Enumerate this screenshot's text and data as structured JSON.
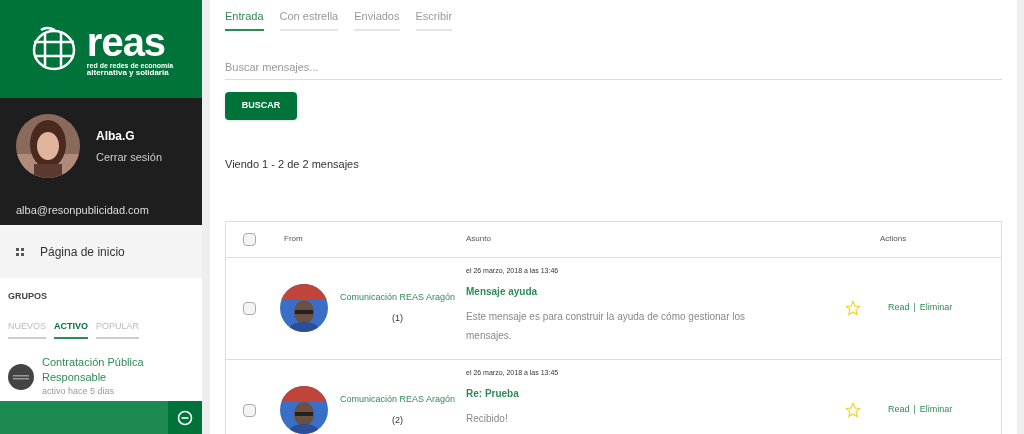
{
  "logo": {
    "name": "reas",
    "tagline_1": "red de redes de economía",
    "tagline_2": "alternativa y solidaria"
  },
  "user": {
    "name": "Alba.G",
    "logout": "Cerrar sesión",
    "email": "alba@resonpublicidad.com"
  },
  "nav": [
    {
      "label": "Página de inicio"
    }
  ],
  "groups": {
    "title": "GRUPOS",
    "tabs": [
      {
        "label": "NUEVOS",
        "selected": false
      },
      {
        "label": "ACTIVO",
        "selected": true
      },
      {
        "label": "POPULAR",
        "selected": false
      }
    ],
    "items": [
      {
        "name": "Contratación Pública Responsable",
        "activity": "activo hace 5 dias"
      }
    ]
  },
  "tabs": [
    {
      "label": "Entrada",
      "selected": true
    },
    {
      "label": "Con estrella",
      "selected": false
    },
    {
      "label": "Enviados",
      "selected": false
    },
    {
      "label": "Escribir",
      "selected": false
    }
  ],
  "search": {
    "placeholder": "Buscar mensajes...",
    "button": "BUSCAR"
  },
  "summary": "Viendo 1 - 2 de 2 mensajes",
  "table": {
    "select_all_checked": false,
    "columns": [
      "From",
      "Asunto",
      "Actions"
    ],
    "rows": [
      {
        "checked": false,
        "from": "Comunicación REAS Aragón",
        "count": "(1)",
        "date": "el 26 marzo, 2018 a las 13:46",
        "subject": "Mensaje ayuda",
        "body": "Este mensaje es para construir la ayuda de cómo gestionar los mensajes.",
        "starred": false,
        "read": "Read",
        "separator": "|",
        "delete": "Eliminar"
      },
      {
        "checked": false,
        "from": "Comunicación REAS Aragón",
        "count": "(2)",
        "date": "el 26 marzo, 2018 a las 13:45",
        "subject": "Re: Prueba",
        "body": "Recibido!",
        "starred": false,
        "read": "Read",
        "separator": "|",
        "delete": "Eliminar"
      }
    ]
  }
}
